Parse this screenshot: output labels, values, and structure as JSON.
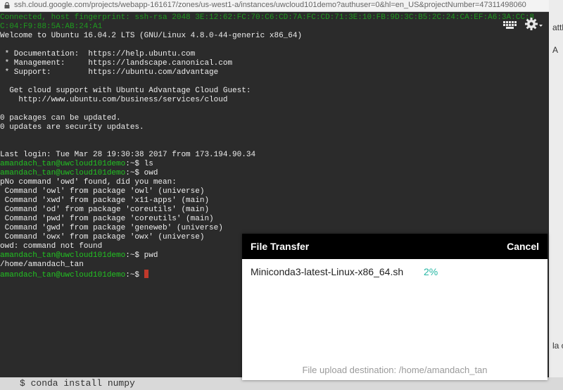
{
  "browser": {
    "url": "ssh.cloud.google.com/projects/webapp-161617/zones/us-west1-a/instances/uwcloud101demo?authuser=0&hl=en_US&projectNumber=47311498060"
  },
  "background": {
    "right_snippets": [
      "attle",
      "A",
      "la c"
    ],
    "bottom_code": "$ conda install numpy"
  },
  "terminal": {
    "lines": [
      {
        "text": "Connected, host fingerprint: ssh-rsa 2048 3E:12:62:FC:70:C6:CD:7A:FC:CD:71:3E:10:FB:9D:3C:B5:2C:24:CA:EF:A6:3A:CC:8",
        "style": "faded"
      },
      {
        "text": "C:04:F9:88:5A:AB:24:A1",
        "style": "faded"
      },
      {
        "text": "Welcome to Ubuntu 16.04.2 LTS (GNU/Linux 4.8.0-44-generic x86_64)",
        "style": "plain"
      },
      {
        "text": "",
        "style": "plain"
      },
      {
        "text": " * Documentation:  https://help.ubuntu.com",
        "style": "plain"
      },
      {
        "text": " * Management:     https://landscape.canonical.com",
        "style": "plain"
      },
      {
        "text": " * Support:        https://ubuntu.com/advantage",
        "style": "plain"
      },
      {
        "text": "",
        "style": "plain"
      },
      {
        "text": "  Get cloud support with Ubuntu Advantage Cloud Guest:",
        "style": "plain"
      },
      {
        "text": "    http://www.ubuntu.com/business/services/cloud",
        "style": "plain"
      },
      {
        "text": "",
        "style": "plain"
      },
      {
        "text": "0 packages can be updated.",
        "style": "plain"
      },
      {
        "text": "0 updates are security updates.",
        "style": "plain"
      },
      {
        "text": "",
        "style": "plain"
      },
      {
        "text": "",
        "style": "plain"
      },
      {
        "text": "Last login: Tue Mar 28 19:30:38 2017 from 173.194.90.34",
        "style": "plain"
      },
      {
        "prompt": "amandach_tan@uwcloud101demo",
        "text": ":~$ ls",
        "style": "prompt"
      },
      {
        "prompt": "amandach_tan@uwcloud101demo",
        "text": ":~$ owd",
        "style": "prompt"
      },
      {
        "text": "pNo command 'owd' found, did you mean:",
        "style": "plain"
      },
      {
        "text": " Command 'owl' from package 'owl' (universe)",
        "style": "plain"
      },
      {
        "text": " Command 'xwd' from package 'x11-apps' (main)",
        "style": "plain"
      },
      {
        "text": " Command 'od' from package 'coreutils' (main)",
        "style": "plain"
      },
      {
        "text": " Command 'pwd' from package 'coreutils' (main)",
        "style": "plain"
      },
      {
        "text": " Command 'gwd' from package 'geneweb' (universe)",
        "style": "plain"
      },
      {
        "text": " Command 'owx' from package 'owx' (universe)",
        "style": "plain"
      },
      {
        "text": "owd: command not found",
        "style": "plain"
      },
      {
        "prompt": "amandach_tan@uwcloud101demo",
        "text": ":~$ pwd",
        "style": "prompt"
      },
      {
        "text": "/home/amandach_tan",
        "style": "plain"
      },
      {
        "prompt": "amandach_tan@uwcloud101demo",
        "text": ":~$ ",
        "style": "prompt",
        "cursor": true
      }
    ],
    "toolbar": {
      "keyboard_icon": "keyboard-icon",
      "settings_icon": "gear-icon"
    }
  },
  "file_transfer": {
    "title": "File Transfer",
    "cancel_label": "Cancel",
    "file_name": "Miniconda3-latest-Linux-x86_64.sh",
    "progress": "2%",
    "destination": "File upload destination: /home/amandach_tan"
  },
  "colors": {
    "terminal_bg": "#2b2b2b",
    "prompt_green": "#22c322",
    "progress_teal": "#27b7a4",
    "cursor_red": "#c0392b"
  }
}
